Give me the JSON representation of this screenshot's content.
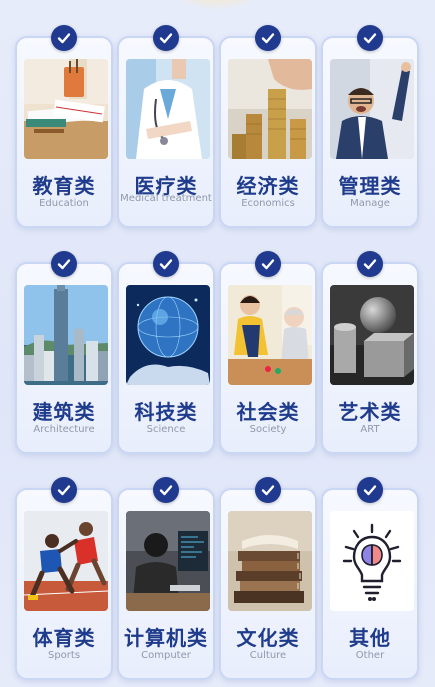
{
  "categories": [
    {
      "title": "教育类",
      "subtitle": "Education",
      "image": "books-on-desk",
      "selected": true
    },
    {
      "title": "医疗类",
      "subtitle": "Medical treatment",
      "image": "doctor",
      "selected": true
    },
    {
      "title": "经济类",
      "subtitle": "Economics",
      "image": "coin-stacks",
      "selected": true
    },
    {
      "title": "管理类",
      "subtitle": "Manage",
      "image": "celebrating-manager",
      "selected": true
    },
    {
      "title": "建筑类",
      "subtitle": "Architecture",
      "image": "city-skyline",
      "selected": true
    },
    {
      "title": "科技类",
      "subtitle": "Science",
      "image": "globe-in-hand",
      "selected": true
    },
    {
      "title": "社会类",
      "subtitle": "Society",
      "image": "volunteer-and-elder",
      "selected": true
    },
    {
      "title": "艺术类",
      "subtitle": "ART",
      "image": "plaster-sculptures",
      "selected": true
    },
    {
      "title": "体育类",
      "subtitle": "Sports",
      "image": "sprinters",
      "selected": true
    },
    {
      "title": "计算机类",
      "subtitle": "Computer",
      "image": "person-at-computer",
      "selected": true
    },
    {
      "title": "文化类",
      "subtitle": "Culture",
      "image": "stack-of-books",
      "selected": true
    },
    {
      "title": "其他",
      "subtitle": "Other",
      "image": "lightbulb-brain-icon",
      "selected": true
    }
  ],
  "colors": {
    "accent": "#1f3a8f",
    "title": "#1f3b8c",
    "subtitle": "#8f98ac"
  }
}
